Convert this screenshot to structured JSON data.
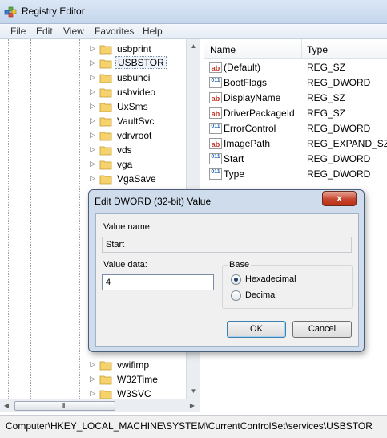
{
  "window": {
    "title": "Registry Editor"
  },
  "menu": [
    "File",
    "Edit",
    "View",
    "Favorites",
    "Help"
  ],
  "tree": {
    "items": [
      {
        "label": "usbprint",
        "selected": false
      },
      {
        "label": "USBSTOR",
        "selected": true
      },
      {
        "label": "usbuhci",
        "selected": false
      },
      {
        "label": "usbvideo",
        "selected": false
      },
      {
        "label": "UxSms",
        "selected": false
      },
      {
        "label": "VaultSvc",
        "selected": false
      },
      {
        "label": "vdrvroot",
        "selected": false
      },
      {
        "label": "vds",
        "selected": false
      },
      {
        "label": "vga",
        "selected": false
      },
      {
        "label": "VgaSave",
        "selected": false
      }
    ],
    "bottom_items": [
      {
        "label": "vwifimp"
      },
      {
        "label": "W32Time"
      },
      {
        "label": "W3SVC"
      }
    ],
    "scroll_grip": "III"
  },
  "list": {
    "headers": {
      "name": "Name",
      "type": "Type"
    },
    "rows": [
      {
        "icon": "string-value-icon",
        "glyph": "ab",
        "name": "(Default)",
        "type": "REG_SZ"
      },
      {
        "icon": "binary-value-icon",
        "glyph": "011",
        "name": "BootFlags",
        "type": "REG_DWORD"
      },
      {
        "icon": "string-value-icon",
        "glyph": "ab",
        "name": "DisplayName",
        "type": "REG_SZ"
      },
      {
        "icon": "string-value-icon",
        "glyph": "ab",
        "name": "DriverPackageId",
        "type": "REG_SZ"
      },
      {
        "icon": "binary-value-icon",
        "glyph": "011",
        "name": "ErrorControl",
        "type": "REG_DWORD"
      },
      {
        "icon": "string-value-icon",
        "glyph": "ab",
        "name": "ImagePath",
        "type": "REG_EXPAND_SZ"
      },
      {
        "icon": "binary-value-icon",
        "glyph": "011",
        "name": "Start",
        "type": "REG_DWORD"
      },
      {
        "icon": "binary-value-icon",
        "glyph": "011",
        "name": "Type",
        "type": "REG_DWORD"
      }
    ]
  },
  "dialog": {
    "title": "Edit DWORD (32-bit) Value",
    "close_glyph": "x",
    "value_name_label": "Value name:",
    "value_name": "Start",
    "value_data_label": "Value data:",
    "value_data": "4",
    "base_label": "Base",
    "base_options": [
      {
        "label": "Hexadecimal",
        "checked": true
      },
      {
        "label": "Decimal",
        "checked": false
      }
    ],
    "ok_label": "OK",
    "cancel_label": "Cancel"
  },
  "status_bar": {
    "path": "Computer\\HKEY_LOCAL_MACHINE\\SYSTEM\\CurrentControlSet\\services\\USBSTOR"
  }
}
